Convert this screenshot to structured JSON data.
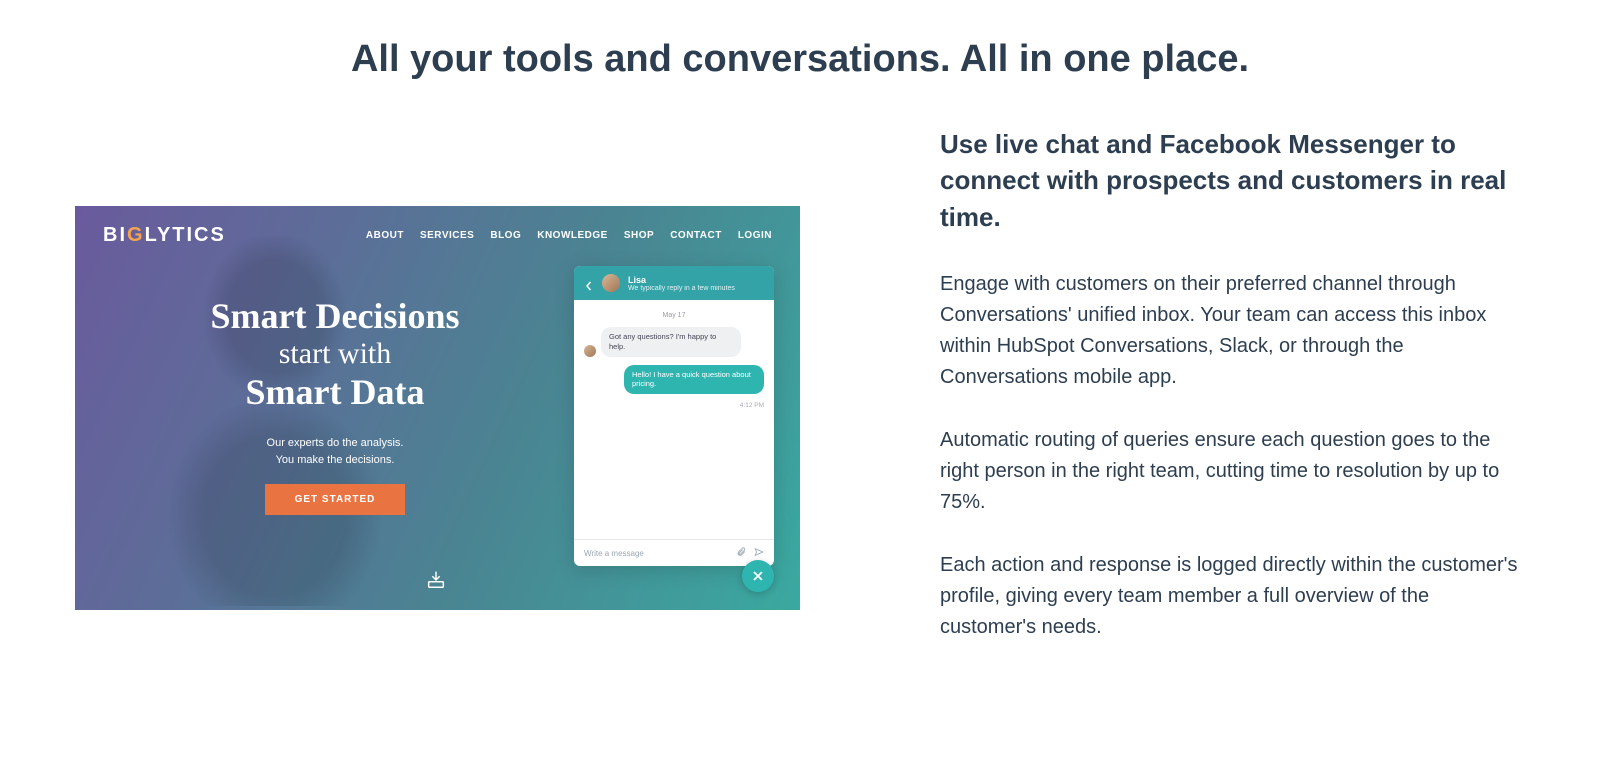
{
  "title": "All your tools and conversations. All in one place.",
  "demo": {
    "logo_prefix": "BI",
    "logo_o": "G",
    "logo_suffix": "LYTICS",
    "nav": [
      "ABOUT",
      "SERVICES",
      "BLOG",
      "KNOWLEDGE",
      "SHOP",
      "CONTACT",
      "LOGIN"
    ],
    "hero_line1": "Smart Decisions",
    "hero_line2": "start with",
    "hero_line3": "Smart Data",
    "hero_sub1": "Our experts do the analysis.",
    "hero_sub2": "You make the decisions.",
    "cta": "GET STARTED"
  },
  "chat": {
    "name": "Lisa",
    "subtitle": "We typically reply in a few minutes",
    "date": "May 17",
    "msg_agent": "Got any questions? I'm happy to help.",
    "msg_user": "Hello! I have a quick question about pricing.",
    "time": "4:12 PM",
    "placeholder": "Write a message"
  },
  "right": {
    "heading": "Use live chat and Facebook Messenger to connect with prospects and customers in real time.",
    "p1": "Engage with customers on their preferred channel through Conversations' unified inbox. Your team can access this inbox within HubSpot Conversations, Slack, or through the Conversations mobile app.",
    "p2": "Automatic routing of queries ensure each question goes to the right person in the right team, cutting time to resolution by up to 75%.",
    "p3": "Each action and response is logged directly within the customer's profile, giving every team member a full overview of the customer's needs."
  }
}
